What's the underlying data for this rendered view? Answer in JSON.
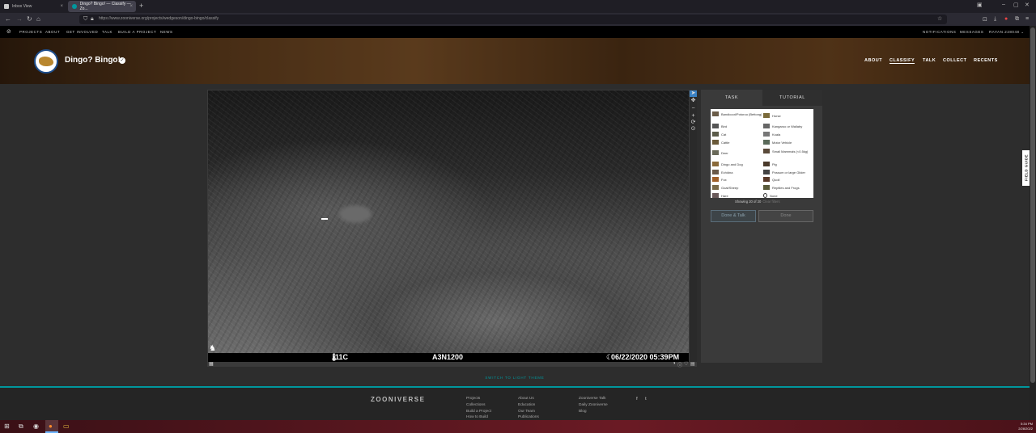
{
  "browser": {
    "tabs": [
      {
        "title": "Inbox View",
        "close": "×"
      },
      {
        "title": "Dingo? Bingo! — Classify — Zo...",
        "close": "×"
      }
    ],
    "new_tab": "+",
    "url": "https://www.zooniverse.org/projects/wedgeson/dingo-bingo/classify"
  },
  "zoo_nav": {
    "items": [
      "PROJECTS",
      "ABOUT",
      "GET INVOLVED",
      "TALK",
      "BUILD A PROJECT",
      "NEWS"
    ],
    "right": [
      "NOTIFICATIONS",
      "MESSAGES",
      "RAYAN.228048"
    ]
  },
  "project": {
    "title": "Dingo? Bingo!",
    "nav": [
      "ABOUT",
      "CLASSIFY",
      "TALK",
      "COLLECT",
      "RECENTS"
    ]
  },
  "camera_caption": {
    "temperature": "11C",
    "camera_id": "A3N1200",
    "datetime": "06/22/2020  05:39PM"
  },
  "task": {
    "tabs": [
      "TASK",
      "TUTORIAL"
    ],
    "choices": [
      "Bandicoot/Potoroo (Bettong)",
      "Horse",
      "Bird",
      "Kangaroo or Wallaby",
      "Cat",
      "Koala",
      "Cattle",
      "Motor Vehicle",
      "Deer",
      "Small Mammals (<0.5kg)",
      "Dingo and Dog",
      "Pig",
      "Echidna",
      "Possum or large Glider",
      "Fox",
      "Quoll",
      "Goat/Sheep",
      "Reptiles and Frogs",
      "Hare",
      "None"
    ],
    "showing": "Showing 20 of 20",
    "clear_filters": "Clear filters",
    "done_talk": "Done & Talk",
    "done": "Done"
  },
  "field_guide": "FIELD GUIDE",
  "switch_theme": "SWITCH TO LIGHT THEME",
  "footer": {
    "logo": "ZOONIVERSE",
    "col1": [
      "Projects",
      "Collections",
      "Build a Project",
      "How to Build"
    ],
    "col2": [
      "About Us",
      "Education",
      "Our Team",
      "Publications"
    ],
    "col3": [
      "Zooniverse Talk",
      "Daily Zooniverse",
      "Blog"
    ],
    "social": [
      "f",
      "t"
    ]
  },
  "taskbar": {
    "time": "5:34 PM",
    "date": "2/28/2022"
  }
}
